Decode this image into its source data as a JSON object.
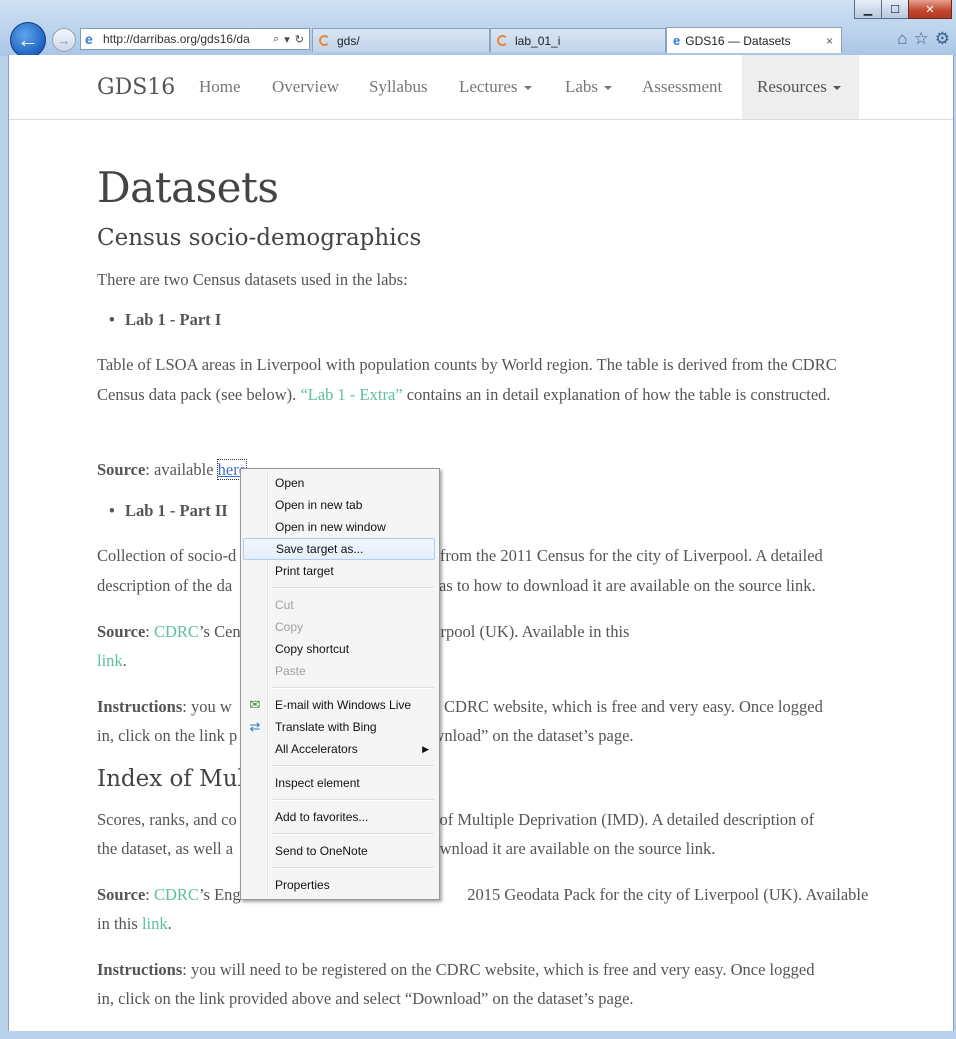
{
  "browser": {
    "address_url": "http://darribas.org/gds16/da",
    "tabs": [
      {
        "label": "gds/"
      },
      {
        "label": "lab_01_i"
      },
      {
        "label": "GDS16 — Datasets"
      }
    ],
    "tab_close": "×",
    "window_buttons": {
      "minimize": "▁",
      "maximize": "☐",
      "close": "✕"
    }
  },
  "site": {
    "brand": "GDS16",
    "nav": [
      {
        "label": "Home"
      },
      {
        "label": "Overview"
      },
      {
        "label": "Syllabus"
      },
      {
        "label": "Lectures"
      },
      {
        "label": "Labs"
      },
      {
        "label": "Assessment"
      },
      {
        "label": "Resources"
      }
    ]
  },
  "content": {
    "title": "Datasets",
    "census_heading": "Census socio-demographics",
    "intro": "There are two Census datasets used in the labs:",
    "lab1_part1": "Lab 1 - Part I",
    "lab1_desc_a": "Table of LSOA areas in Liverpool with population counts by World region. The table is derived from the CDRC Census data pack (see below). ",
    "lab1_desc_link": "“Lab 1 - Extra”",
    "lab1_desc_b": " contains an in detail explanation of how the table is constructed.",
    "source_label": "Source",
    "source1_text": ": available ",
    "source1_link": "here",
    "lab1_part2": "Lab 1 - Part II",
    "part2_desc_a": "Collection of socio-d",
    "part2_desc_b": "s from the 2011 Census for the city of Liverpool. A detailed",
    "part2_desc_c": "description of the da",
    "part2_desc_d": "ns as to how to download it are available on the source link.",
    "cdrc": "CDRC",
    "source2_a": "’s Cen",
    "source2_b": "f Liverpool (UK). Available in this",
    "link_word": "link",
    "instructions_label": "Instructions",
    "instr1_a": ": you w",
    "instr1_b": "the CDRC website, which is free and very easy. Once logged",
    "instr1_c": "in, click on the link p",
    "instr1_d": "Download” on the dataset’s page.",
    "imd_heading_a": "Index of Mult",
    "imd_desc_a": "Scores, ranks, and co",
    "imd_desc_b": "ex of Multiple Deprivation (IMD). A detailed description of",
    "imd_desc_c": "the dataset, as well a",
    "imd_desc_d": "download it are available on the source link.",
    "source3_a": "’s Engl",
    "source3_b": "2015 Geodata Pack for the city of Liverpool (UK). Available",
    "source3_c": "in this ",
    "instr2_a": ": you will need to be registered on the CDRC website, which is free and very easy. Once logged",
    "instr2_b": "in, click on the link provided above and select “Download” on the dataset’s page."
  },
  "context_menu": {
    "items": [
      {
        "label": "Open",
        "enabled": true
      },
      {
        "label": "Open in new tab",
        "enabled": true
      },
      {
        "label": "Open in new window",
        "enabled": true
      },
      {
        "label": "Save target as...",
        "enabled": true,
        "highlighted": true
      },
      {
        "label": "Print target",
        "enabled": true
      },
      {
        "label": "Cut",
        "enabled": false
      },
      {
        "label": "Copy",
        "enabled": false
      },
      {
        "label": "Copy shortcut",
        "enabled": true
      },
      {
        "label": "Paste",
        "enabled": false
      },
      {
        "label": "E-mail with Windows Live",
        "enabled": true,
        "icon": "email-icon"
      },
      {
        "label": "Translate with Bing",
        "enabled": true,
        "icon": "translate-icon"
      },
      {
        "label": "All Accelerators",
        "enabled": true,
        "submenu": true
      },
      {
        "label": "Inspect element",
        "enabled": true
      },
      {
        "label": "Add to favorites...",
        "enabled": true
      },
      {
        "label": "Send to OneNote",
        "enabled": true
      },
      {
        "label": "Properties",
        "enabled": true
      }
    ],
    "submenu_arrow": "▶"
  },
  "colors": {
    "link": "#5cbfa0",
    "text": "#555555",
    "nav_active_bg": "#eeeeee"
  }
}
